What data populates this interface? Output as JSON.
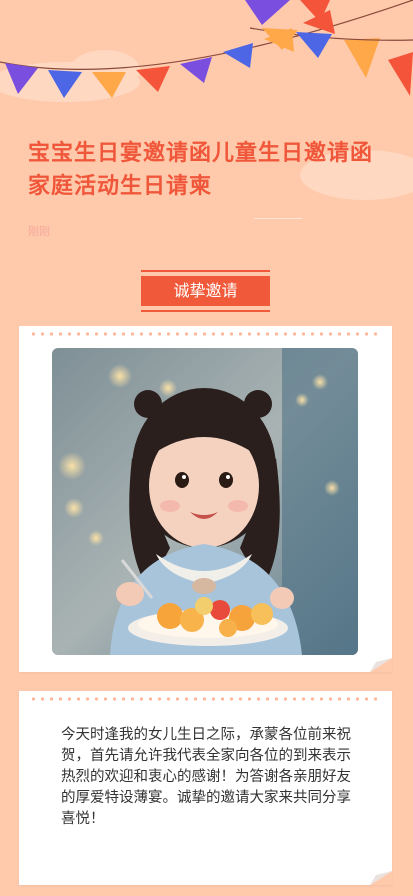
{
  "article": {
    "title": "宝宝生日宴邀请函儿童生日邀请函家庭活动生日请柬",
    "author": "刚刚"
  },
  "badge": {
    "label": "诚挚邀请"
  },
  "photo": {
    "alt": "小女孩手拿叉子吃水果盘"
  },
  "message": {
    "text": "今天时逢我的女儿生日之际，承蒙各位前来祝贺，首先请允许我代表全家向各位的到来表示热烈的欢迎和衷心的感谢！为答谢各亲朋好友的厚爱特设薄宴。诚挚的邀请大家来共同分享喜悦！"
  },
  "colors": {
    "background": "#ffc9ac",
    "accent": "#f05a3a",
    "flag_purple": "#7a4fe0",
    "flag_blue": "#4c66e6",
    "flag_orange": "#ffa84a",
    "flag_red": "#f4553a"
  }
}
